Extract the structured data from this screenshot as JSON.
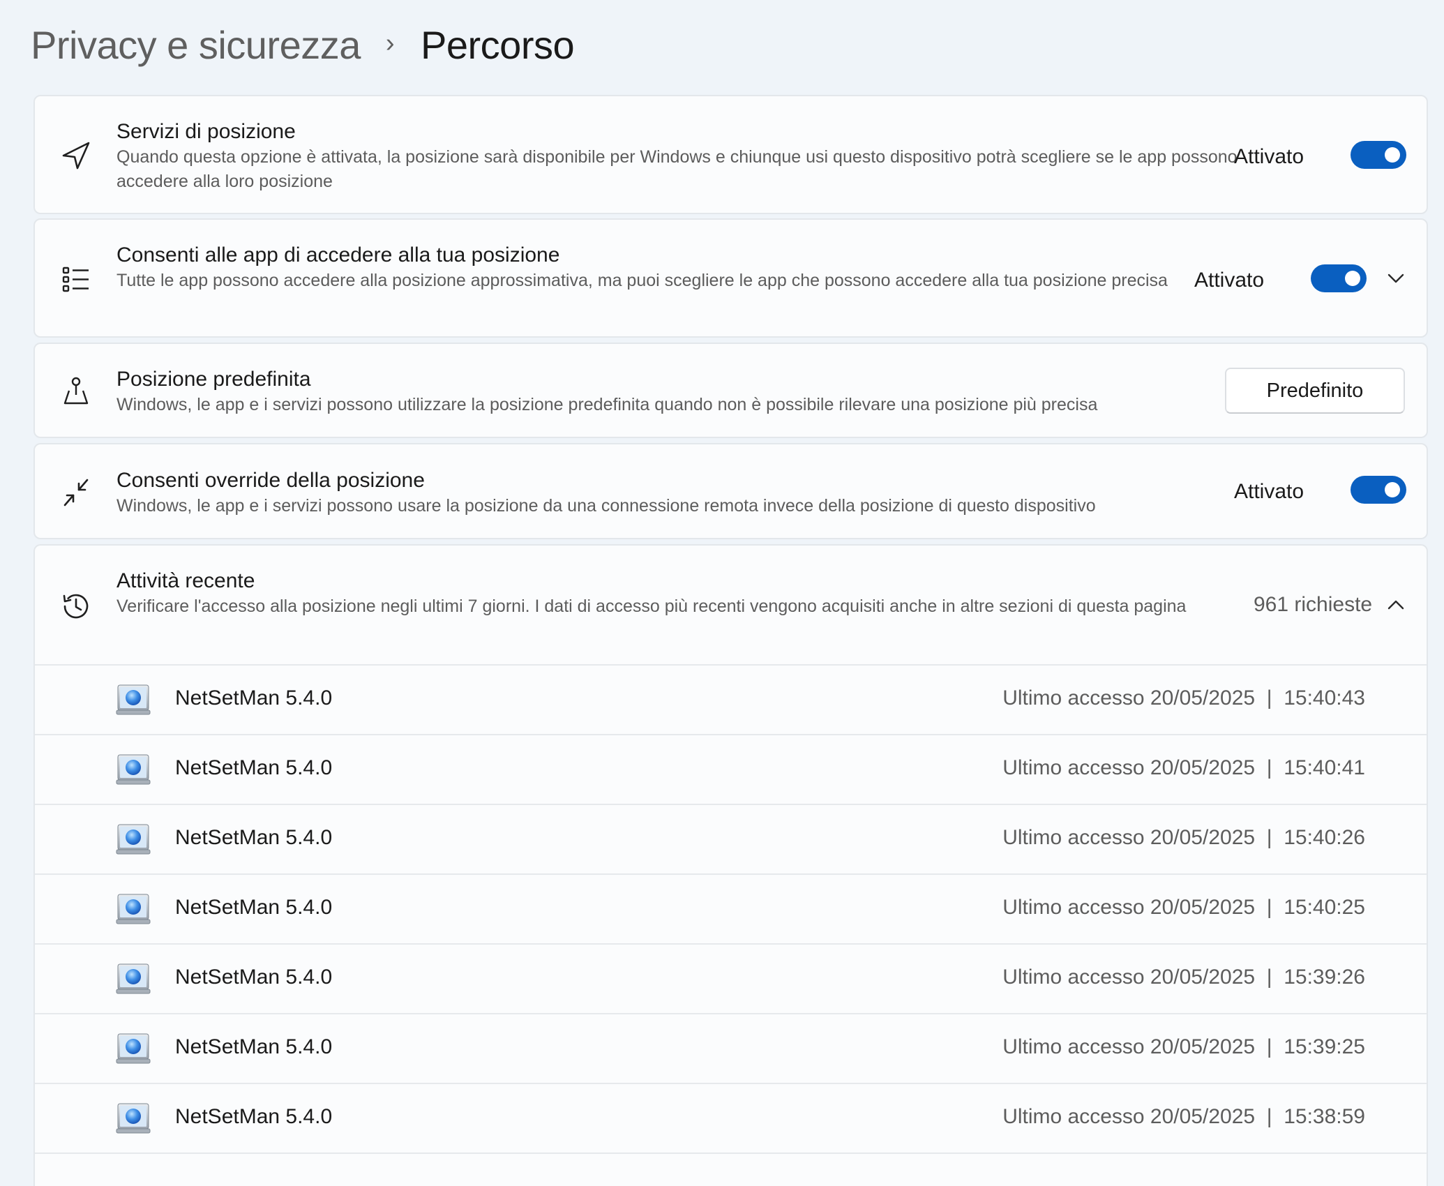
{
  "breadcrumb": {
    "parent": "Privacy e sicurezza",
    "separator": "›",
    "current": "Percorso"
  },
  "location_services": {
    "title": "Servizi di posizione",
    "description": "Quando questa opzione è attivata, la posizione sarà disponibile per Windows e chiunque usi questo dispositivo potrà scegliere se le app possono accedere alla loro posizione",
    "state": "Attivato"
  },
  "app_access": {
    "title": "Consenti alle app di accedere alla tua posizione",
    "description": "Tutte le app possono accedere alla posizione approssimativa, ma puoi scegliere le app che possono accedere alla tua posizione precisa",
    "state": "Attivato"
  },
  "default_location": {
    "title": "Posizione predefinita",
    "description": "Windows, le app e i servizi possono utilizzare la posizione predefinita quando non è possibile rilevare una posizione più precisa",
    "button": "Predefinito"
  },
  "location_override": {
    "title": "Consenti override della posizione",
    "description": "Windows, le app e i servizi possono usare la posizione da una connessione remota invece della posizione di questo dispositivo",
    "state": "Attivato"
  },
  "recent_activity": {
    "title": "Attività recente",
    "description": "Verificare l'accesso alla posizione negli ultimi 7 giorni. I dati di accesso più recenti vengono acquisiti anche in altre sezioni di questa pagina",
    "count": "961 richieste",
    "rows": [
      {
        "app": "NetSetMan 5.4.0",
        "access": "Ultimo accesso 20/05/2025  |  15:40:43"
      },
      {
        "app": "NetSetMan 5.4.0",
        "access": "Ultimo accesso 20/05/2025  |  15:40:41"
      },
      {
        "app": "NetSetMan 5.4.0",
        "access": "Ultimo accesso 20/05/2025  |  15:40:26"
      },
      {
        "app": "NetSetMan 5.4.0",
        "access": "Ultimo accesso 20/05/2025  |  15:40:25"
      },
      {
        "app": "NetSetMan 5.4.0",
        "access": "Ultimo accesso 20/05/2025  |  15:39:26"
      },
      {
        "app": "NetSetMan 5.4.0",
        "access": "Ultimo accesso 20/05/2025  |  15:39:25"
      },
      {
        "app": "NetSetMan 5.4.0",
        "access": "Ultimo accesso 20/05/2025  |  15:38:59"
      }
    ]
  },
  "icons": {
    "location": "navigation-arrow-icon",
    "app_list": "list-icon",
    "default_location": "map-pin-icon",
    "override": "remote-arrows-icon",
    "activity": "history-icon",
    "app": "app-window-icon"
  },
  "colors": {
    "accent": "#0a5fc0",
    "background": "#eff4f9",
    "card": "#fbfcfd"
  }
}
